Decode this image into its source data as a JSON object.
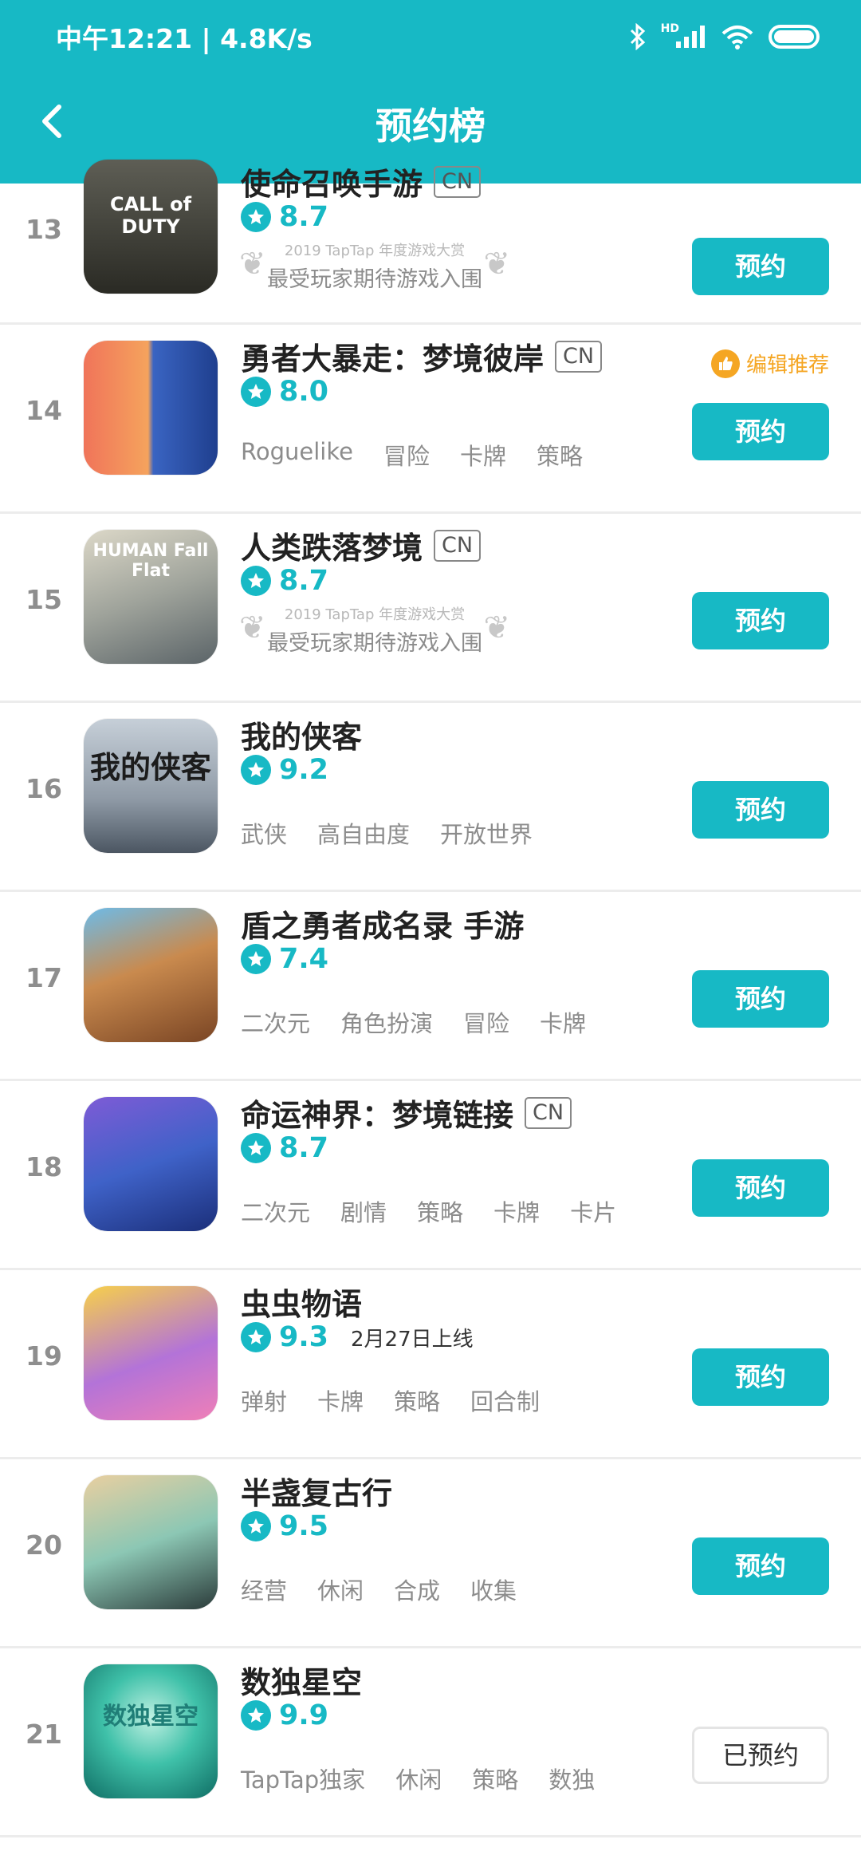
{
  "status_bar": {
    "time_speed": "中午12:21 | 4.8K/s",
    "hd_label": "HD"
  },
  "header": {
    "title": "预约榜"
  },
  "colors": {
    "accent": "#17b9c5",
    "badge": "#f5a623"
  },
  "award": {
    "line1": "2019 TapTap 年度游戏大赏",
    "line2": "最受玩家期待游戏入围"
  },
  "editor_badge": "编辑推荐",
  "games": [
    {
      "rank": "13",
      "name": "使命召唤手游",
      "cn": "CN",
      "score": "8.7",
      "button": "预约",
      "icon_caption": "CALL of DUTY",
      "icon_name": "call-of-duty-icon"
    },
    {
      "rank": "14",
      "name": "勇者大暴走：梦境彼岸",
      "cn": "CN",
      "score": "8.0",
      "tags": [
        "Roguelike",
        "冒险",
        "卡牌",
        "策略"
      ],
      "button": "预约",
      "icon_name": "hero-rush-icon"
    },
    {
      "rank": "15",
      "name": "人类跌落梦境",
      "cn": "CN",
      "score": "8.7",
      "button": "预约",
      "icon_caption": "HUMAN Fall Flat",
      "icon_name": "human-fall-flat-icon"
    },
    {
      "rank": "16",
      "name": "我的侠客",
      "score": "9.2",
      "tags": [
        "武侠",
        "高自由度",
        "开放世界"
      ],
      "button": "预约",
      "icon_caption": "我的侠客",
      "icon_name": "my-hero-icon"
    },
    {
      "rank": "17",
      "name": "盾之勇者成名录 手游",
      "score": "7.4",
      "tags": [
        "二次元",
        "角色扮演",
        "冒险",
        "卡牌"
      ],
      "button": "预约",
      "icon_name": "shield-hero-icon"
    },
    {
      "rank": "18",
      "name": "命运神界：梦境链接",
      "cn": "CN",
      "score": "8.7",
      "tags": [
        "二次元",
        "剧情",
        "策略",
        "卡牌",
        "卡片"
      ],
      "button": "预约",
      "icon_name": "destiny-realm-icon"
    },
    {
      "rank": "19",
      "name": "虫虫物语",
      "score": "9.3",
      "release": "2月27日上线",
      "tags": [
        "弹射",
        "卡牌",
        "策略",
        "回合制"
      ],
      "button": "预约",
      "icon_name": "bug-story-icon"
    },
    {
      "rank": "20",
      "name": "半盏复古行",
      "score": "9.5",
      "tags": [
        "经营",
        "休闲",
        "合成",
        "收集"
      ],
      "button": "预约",
      "icon_name": "retro-trip-icon"
    },
    {
      "rank": "21",
      "name": "数独星空",
      "score": "9.9",
      "tags": [
        "TapTap独家",
        "休闲",
        "策略",
        "数独"
      ],
      "button": "已预约",
      "icon_caption": "数独星空",
      "icon_name": "sudoku-starry-sky-icon"
    }
  ]
}
